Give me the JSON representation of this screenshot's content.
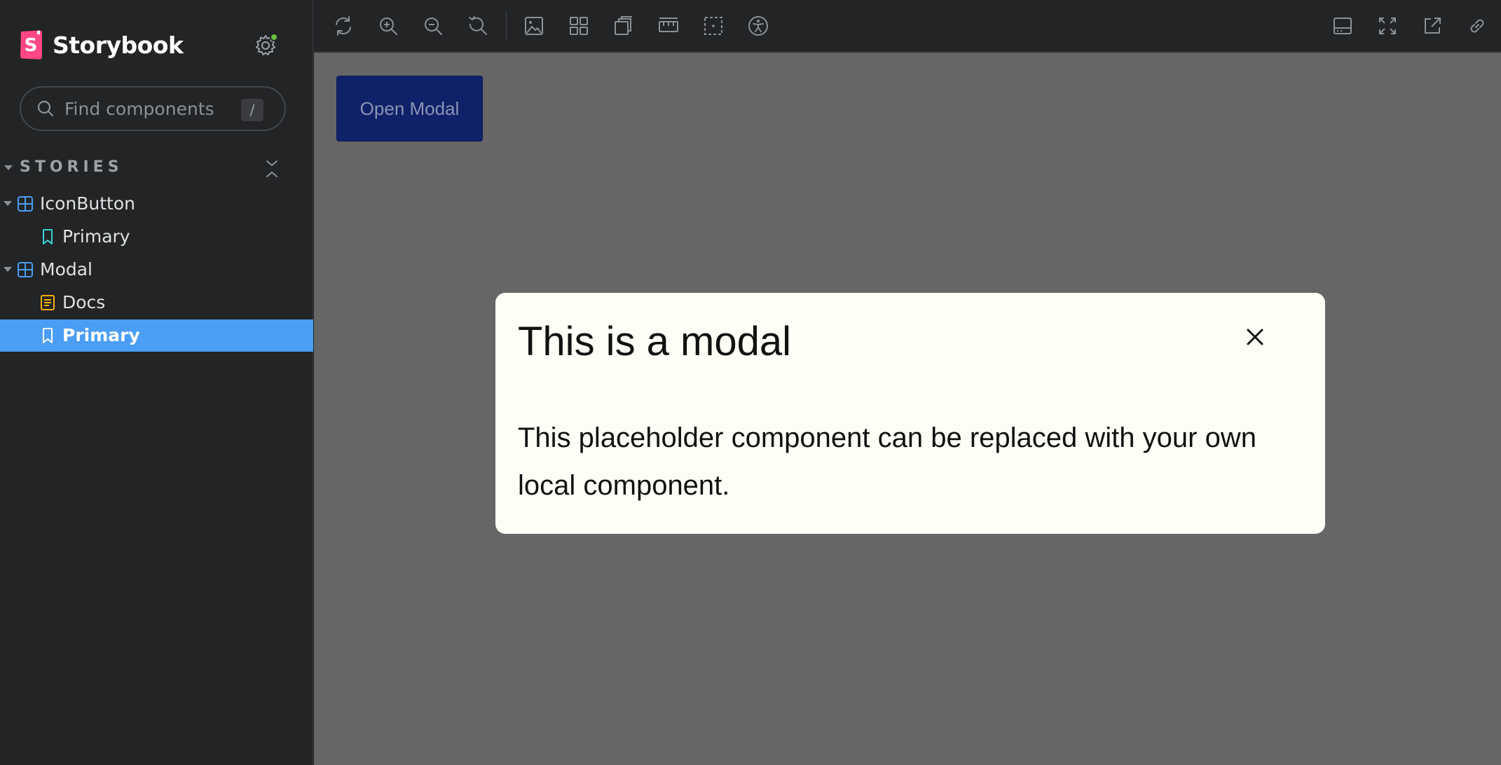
{
  "sidebar": {
    "brand": {
      "name": "Storybook",
      "logo_icon": "storybook-logo-icon",
      "logo_color": "#ff4785"
    },
    "settings": {
      "icon": "gear-icon",
      "status_color": "#66bf3c"
    },
    "search": {
      "placeholder": "Find components",
      "value": "",
      "shortcut": "/"
    },
    "section": {
      "title": "STORIES"
    },
    "tree": [
      {
        "label": "IconButton",
        "type": "component",
        "icon": "component-icon",
        "expanded": true
      },
      {
        "label": "Primary",
        "type": "story",
        "icon": "bookmark-icon"
      },
      {
        "label": "Modal",
        "type": "component",
        "icon": "component-icon",
        "expanded": true
      },
      {
        "label": "Docs",
        "type": "docs",
        "icon": "document-icon"
      },
      {
        "label": "Primary",
        "type": "story",
        "icon": "bookmark-icon",
        "selected": true
      }
    ]
  },
  "toolbar": {
    "left": [
      "reload-icon",
      "zoom-in-icon",
      "zoom-out-icon",
      "zoom-reset-icon",
      "background-icon",
      "grid-icon",
      "viewport-icon",
      "measure-icon",
      "outline-icon",
      "accessibility-icon"
    ],
    "right": [
      "panel-icon",
      "fullscreen-icon",
      "open-new-tab-icon",
      "copy-link-icon"
    ]
  },
  "canvas": {
    "open_modal_label": "Open Modal",
    "modal": {
      "title": "This is a modal",
      "body": "This placeholder component can be replaced with your own local component.",
      "close_icon": "close-icon"
    }
  },
  "colors": {
    "accent": "#4a9ef5",
    "sidebar_bg": "#222425",
    "canvas_bg": "#666666",
    "button_bg": "#0f2169",
    "modal_bg": "#fffef6"
  }
}
